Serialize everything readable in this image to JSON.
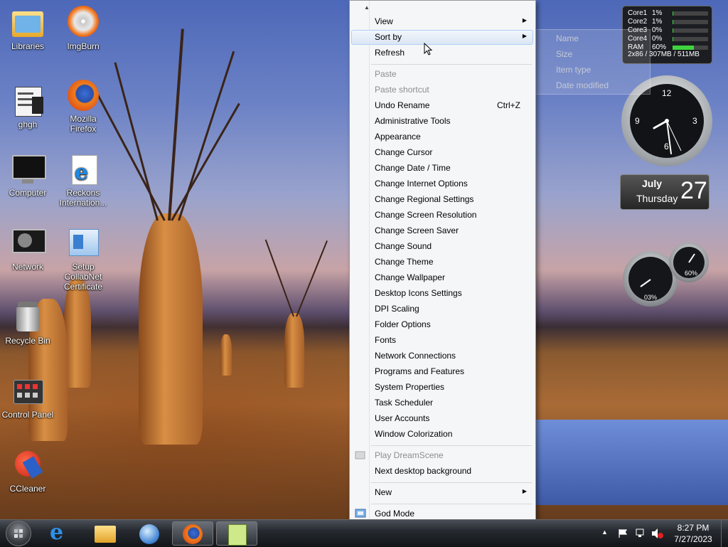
{
  "desktop_icons": {
    "libraries": "Libraries",
    "imgburn": "ImgBurn",
    "ghgh": "ghgh",
    "firefox": "Mozilla Firefox",
    "computer": "Computer",
    "reckons": "Reckons Internation...",
    "network": "Network",
    "setup": "Setup CollabNet Certificate",
    "recycle": "Recycle Bin",
    "control_panel": "Control Panel",
    "ccleaner": "CCleaner"
  },
  "cpu_gadget": {
    "rows": [
      {
        "name": "Core1",
        "pct": "1%",
        "level": 0.01
      },
      {
        "name": "Core2",
        "pct": "1%",
        "level": 0.01
      },
      {
        "name": "Core3",
        "pct": "0%",
        "level": 0.0
      },
      {
        "name": "Core4",
        "pct": "0%",
        "level": 0.0
      },
      {
        "name": "RAM",
        "pct": "60%",
        "level": 0.6
      }
    ],
    "footer": "2x86 / 307MB / 511MB"
  },
  "clock": {
    "n12": "12",
    "n3": "3",
    "n6": "6",
    "n9": "9"
  },
  "calendar": {
    "month": "July",
    "weekday": "Thursday",
    "day": "27"
  },
  "meters": {
    "big": "03%",
    "small": "60%"
  },
  "sort_submenu": {
    "name": "Name",
    "size": "Size",
    "item_type": "Item type",
    "date_modified": "Date modified"
  },
  "context_menu": {
    "view": "View",
    "sort_by": "Sort by",
    "refresh": "Refresh",
    "paste": "Paste",
    "paste_shortcut": "Paste shortcut",
    "undo_rename": "Undo Rename",
    "undo_shortcut": "Ctrl+Z",
    "items": [
      "Administrative Tools",
      "Appearance",
      "Change Cursor",
      "Change Date / Time",
      "Change Internet Options",
      "Change Regional Settings",
      "Change Screen Resolution",
      "Change Screen Saver",
      "Change Sound",
      "Change Theme",
      "Change Wallpaper",
      "Desktop Icons Settings",
      "DPI Scaling",
      "Folder Options",
      "Fonts",
      "Network Connections",
      "Programs and Features",
      "System Properties",
      "Task Scheduler",
      "User Accounts",
      "Window Colorization"
    ],
    "play_dreamscene": "Play DreamScene",
    "next_background": "Next desktop background",
    "new": "New",
    "god_mode": "God Mode"
  },
  "taskbar": {
    "time": "8:27 PM",
    "date": "7/27/2023"
  },
  "icons": {
    "start": "windows-orb-icon",
    "ie": "internet-explorer-icon",
    "explorer": "folder-icon",
    "media": "media-player-icon",
    "firefox": "firefox-icon",
    "notepad": "notepad-plus-icon"
  },
  "colors": {
    "menu_bg": "#f5f6f7",
    "highlight_border": "#aecff7",
    "ram_bar": "#3ed33e"
  }
}
